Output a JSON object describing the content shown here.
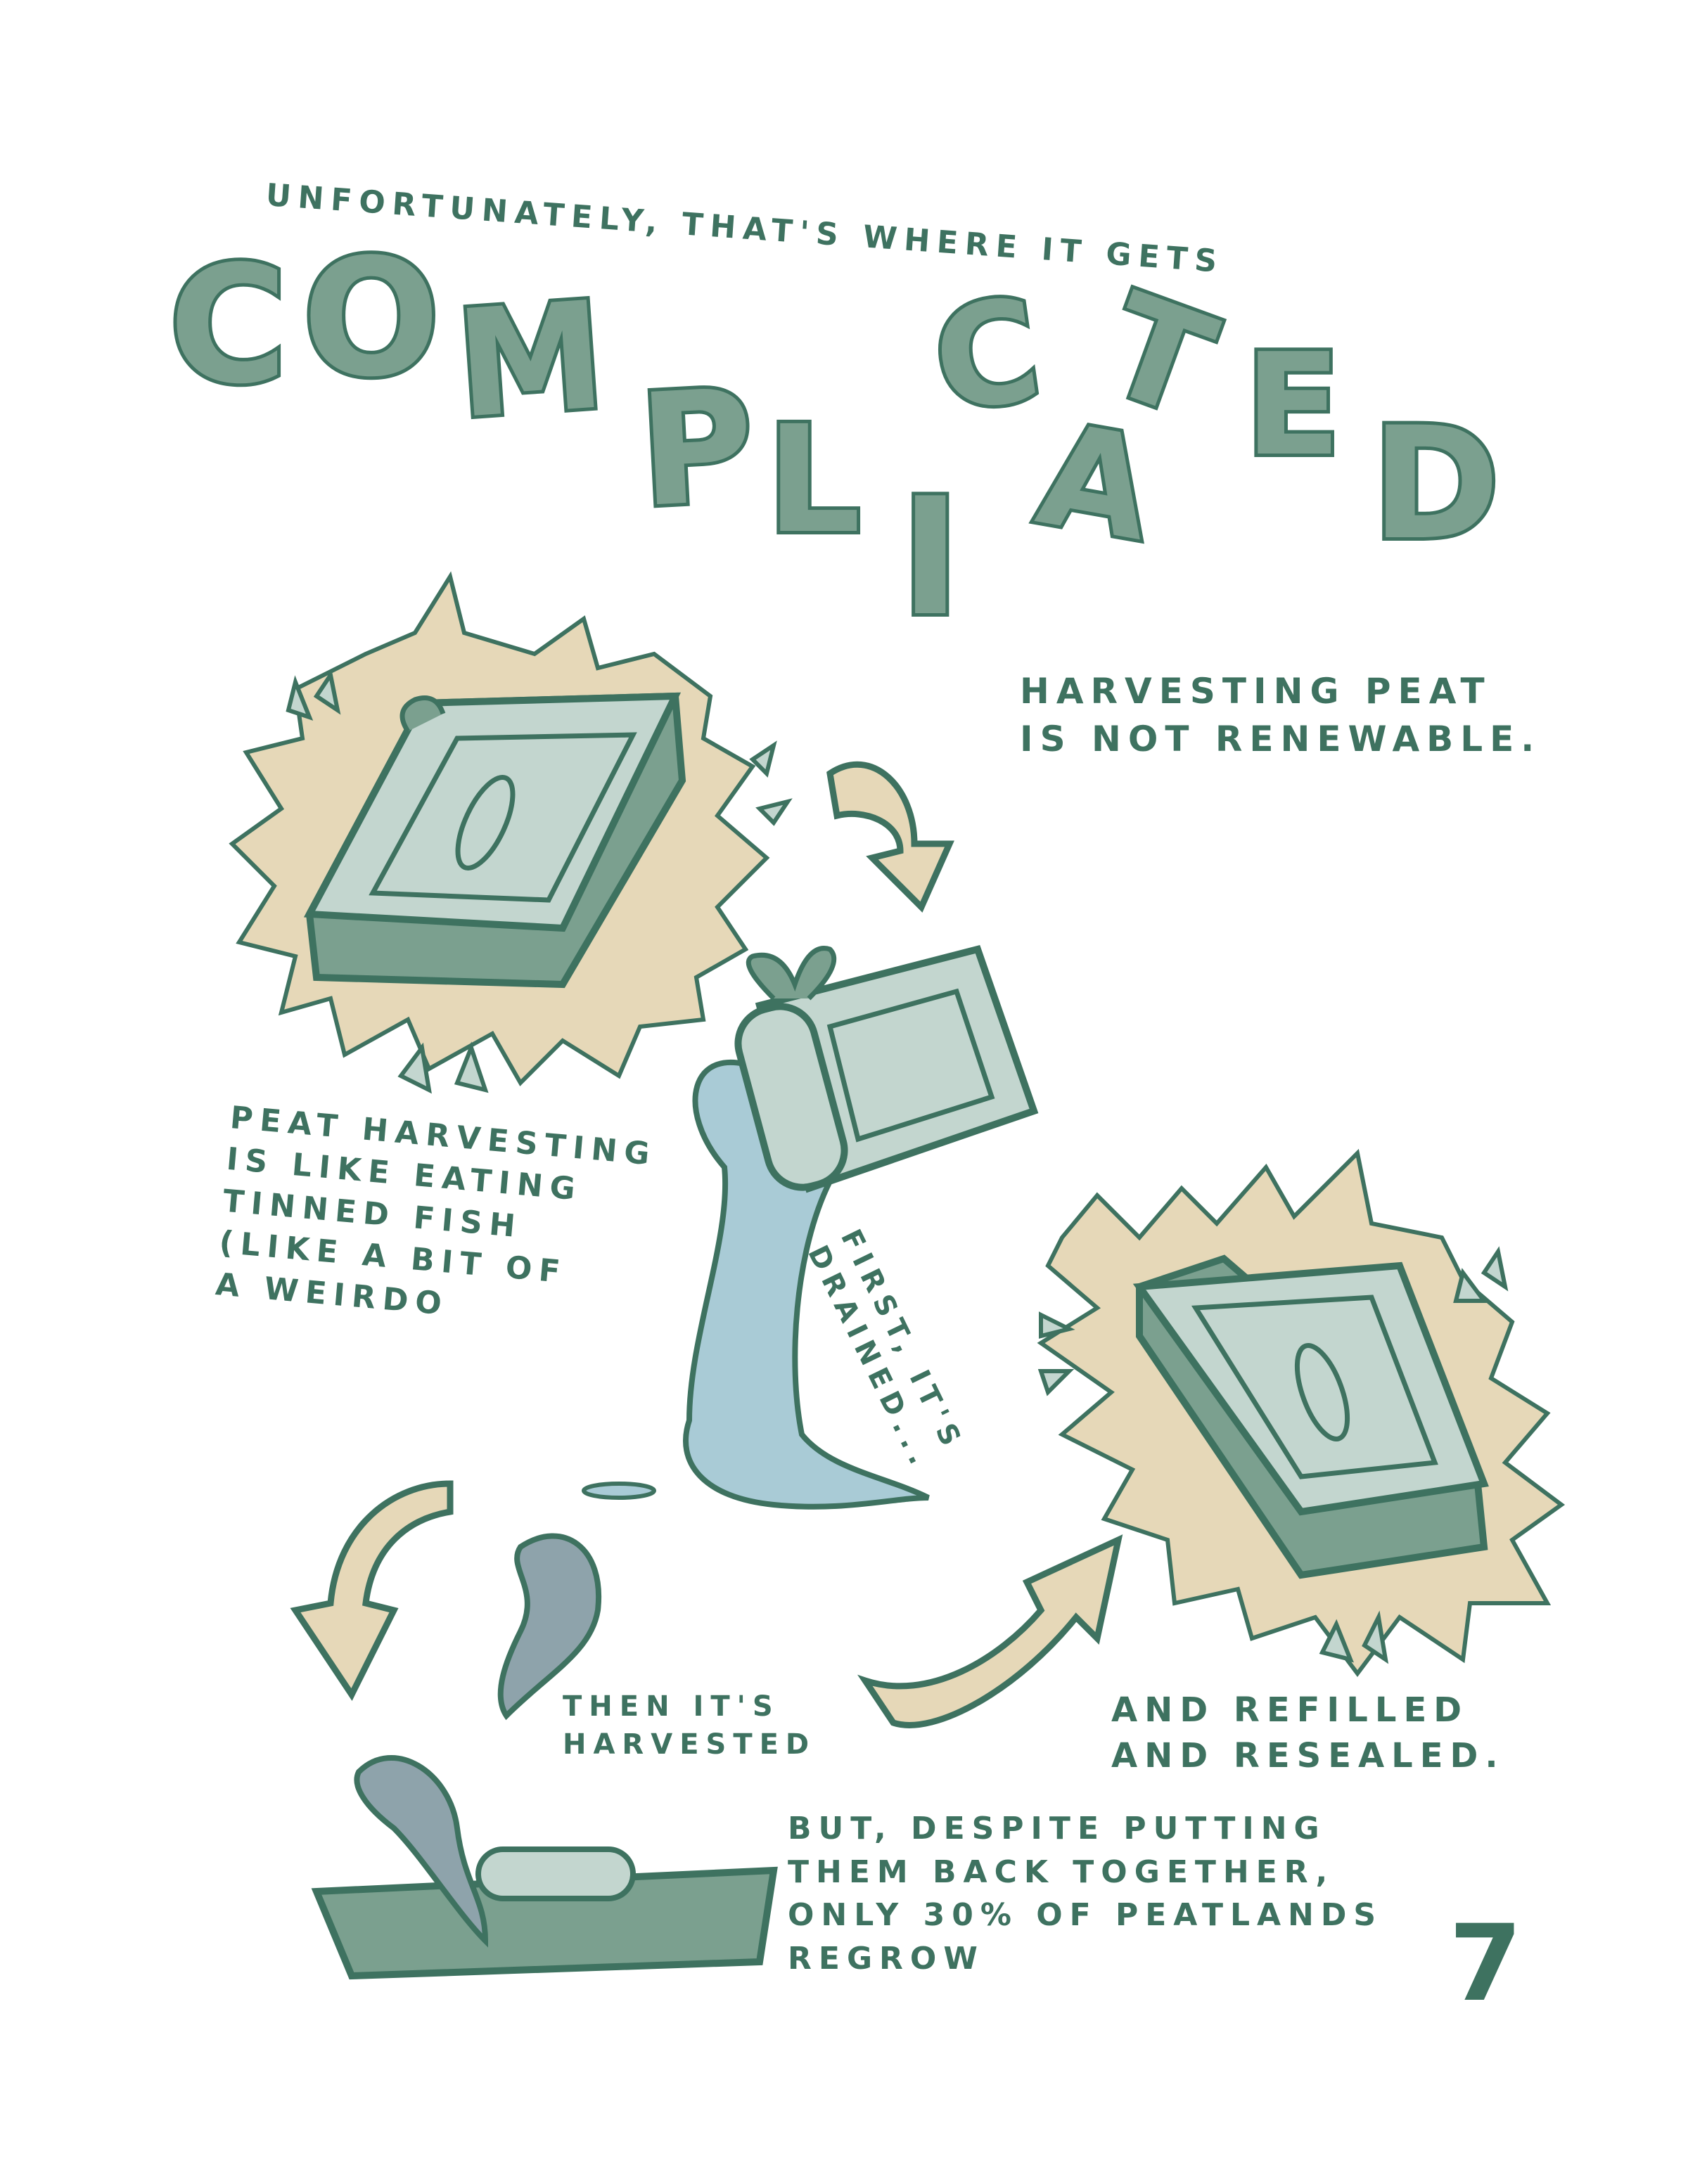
{
  "header": {
    "intro": "UNFORTUNATELY, THAT'S WHERE IT GETS",
    "title_letters": [
      "C",
      "O",
      "M",
      "P",
      "L",
      "I",
      "C",
      "A",
      "T",
      "E",
      "D"
    ]
  },
  "notes": {
    "not_renewable": "HARVESTING PEAT\nIS NOT RENEWABLE.",
    "analogy": "PEAT HARVESTING\nIS LIKE EATING\nTINNED FISH\n(LIKE A BIT OF\nA WEIRDO",
    "drained": "FIRST, IT'S\nDRAINED...",
    "harvested": "THEN IT'S\nHARVESTED",
    "resealed": "AND REFILLED\nAND RESEALED.",
    "regrow": "BUT, DESPITE PUTTING\nTHEM BACK TOGETHER,\nONLY 30% OF PEATLANDS\nREGROW"
  },
  "page_number": "7",
  "colors": {
    "outline": "#3e7260",
    "fill_green": "#7ba08f",
    "light_green": "#c3d6cf",
    "sand": "#e6d8b8",
    "water": "#a9cbd6",
    "fish": "#8ea3ab"
  }
}
